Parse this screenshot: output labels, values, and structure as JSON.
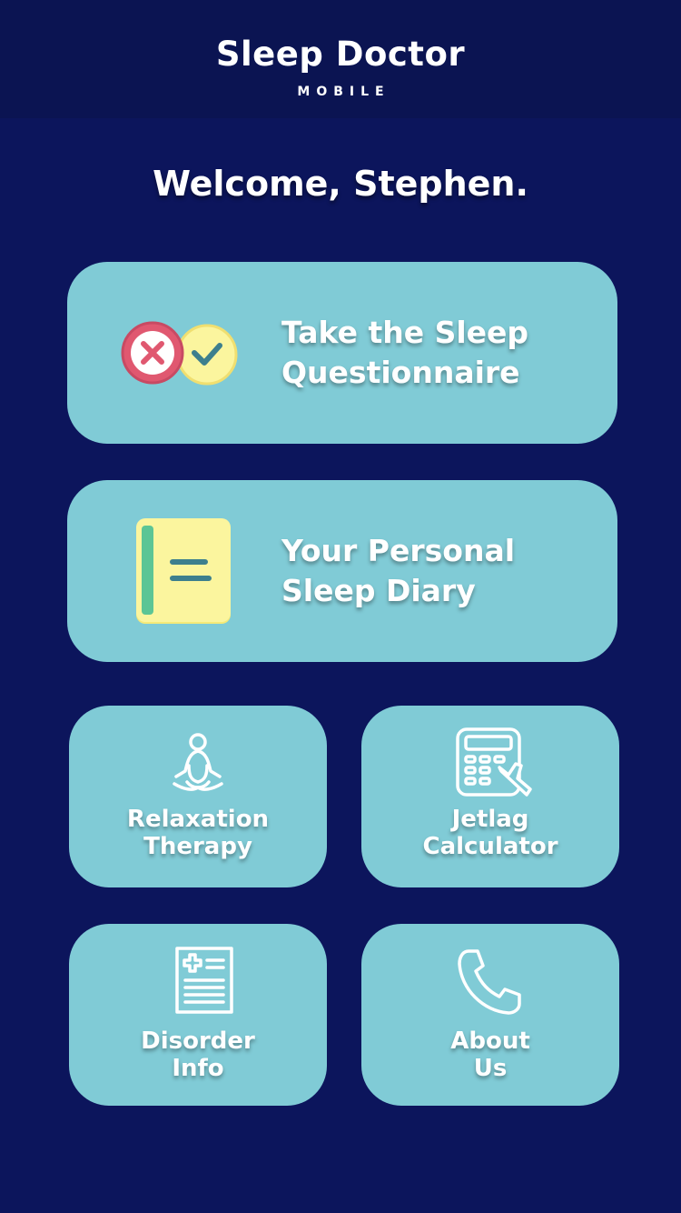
{
  "header": {
    "title": "Sleep Doctor",
    "subtitle": "MOBILE"
  },
  "welcome": "Welcome, Stephen.",
  "menu": [
    {
      "label": "Take the Sleep\nQuestionnaire",
      "icon": "questionnaire-icon"
    },
    {
      "label": "Your Personal\nSleep Diary",
      "icon": "diary-icon"
    },
    {
      "label": "Relaxation\nTherapy",
      "icon": "meditation-icon"
    },
    {
      "label": "Jetlag\nCalculator",
      "icon": "calculator-plane-icon"
    },
    {
      "label": "Disorder\nInfo",
      "icon": "medical-record-icon"
    },
    {
      "label": "About\nUs",
      "icon": "phone-icon"
    }
  ],
  "colors": {
    "background": "#0c155c",
    "header": "#0b1452",
    "card": "#80cbd6",
    "red": "#e05870",
    "yellow": "#fbf59e",
    "green": "#5cc595"
  }
}
